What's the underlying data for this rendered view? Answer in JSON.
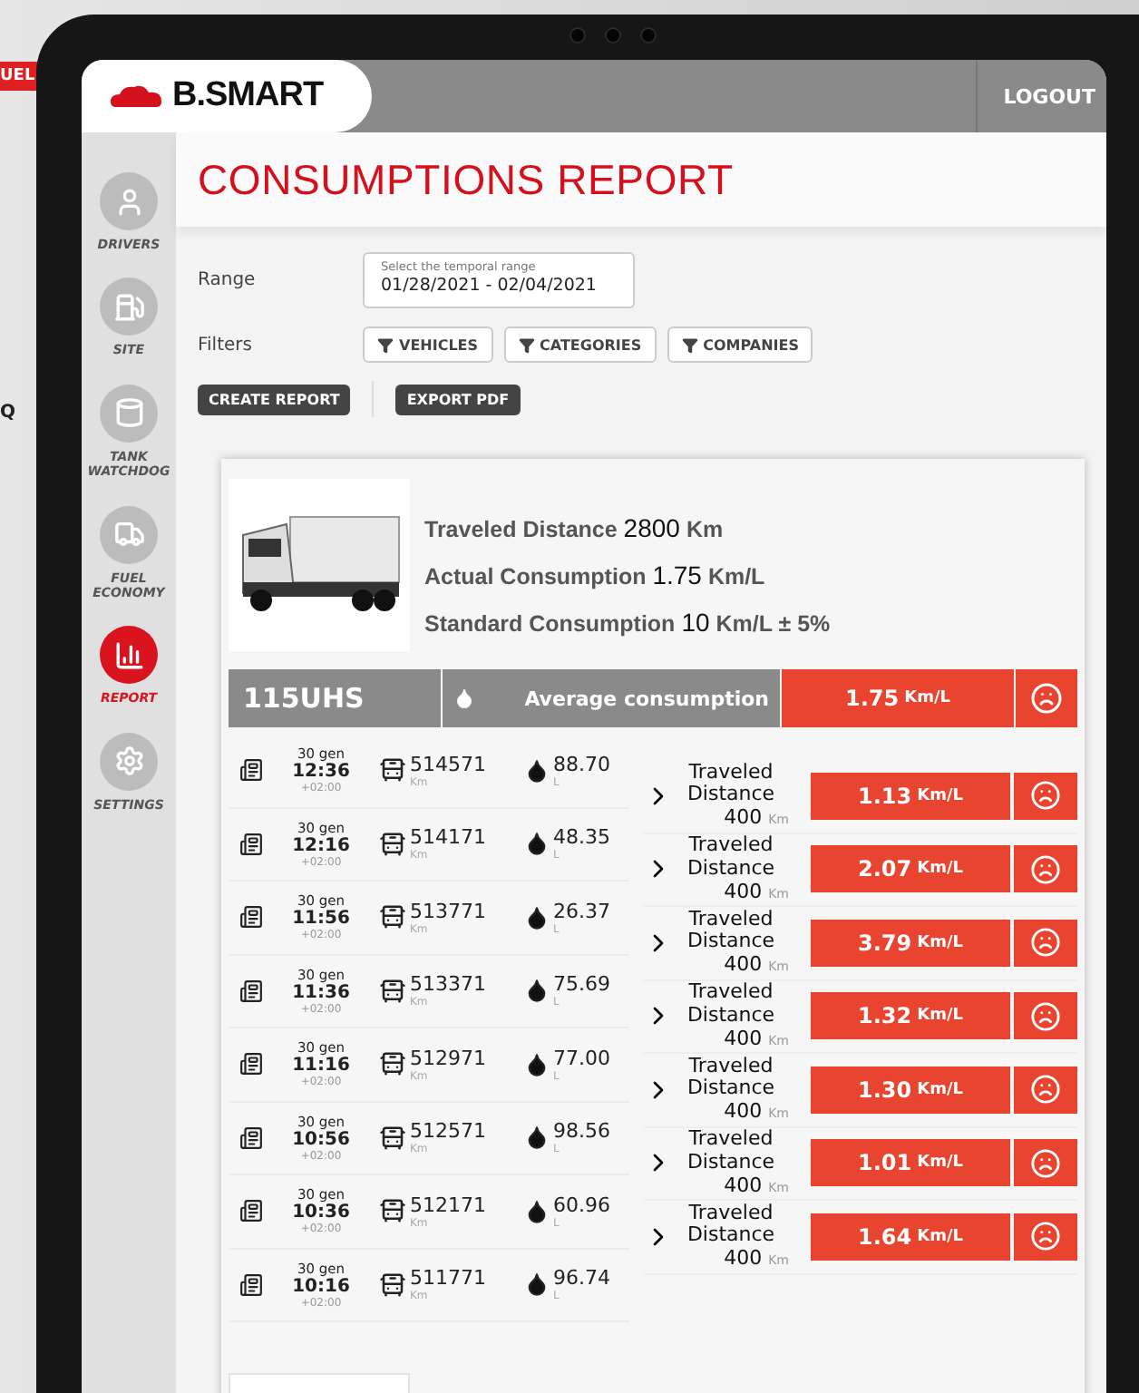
{
  "background": {
    "badge": "UEL",
    "letter": "Q"
  },
  "header": {
    "logo": "B.SMART",
    "logout": "LOGOUT"
  },
  "sidebar": {
    "items": [
      {
        "label": "DRIVERS",
        "selected": false
      },
      {
        "label": "SITE",
        "selected": false
      },
      {
        "label": "TANK WATCHDOG",
        "selected": false
      },
      {
        "label": "FUEL ECONOMY",
        "selected": false
      },
      {
        "label": "REPORT",
        "selected": true
      },
      {
        "label": "SETTINGS",
        "selected": false
      }
    ]
  },
  "title": "CONSUMPTIONS REPORT",
  "range": {
    "label": "Range",
    "field_label": "Select the temporal range",
    "value": "01/28/2021 - 02/04/2021"
  },
  "filters": {
    "label": "Filters",
    "buttons": [
      "VEHICLES",
      "CATEGORIES",
      "COMPANIES"
    ]
  },
  "actions": [
    "CREATE REPORT",
    "EXPORT PDF"
  ],
  "vehicle": {
    "stats": [
      {
        "label": "Traveled Distance",
        "value": "2800",
        "unit": "Km"
      },
      {
        "label": "Actual Consumption",
        "value": "1.75",
        "unit": "Km/L"
      },
      {
        "label": "Standard Consumption",
        "value": "10",
        "unit": "Km/L",
        "extra": "± 5%"
      }
    ],
    "plate": "115UHS",
    "average_label": "Average consumption",
    "average_value": "1.75",
    "average_unit": "Km/L",
    "readings": [
      {
        "date": "30 gen",
        "time": "12:36",
        "tz": "+02:00",
        "odometer": "514571",
        "odometer_unit": "Km",
        "liters": "88.70",
        "liters_unit": "L"
      },
      {
        "date": "30 gen",
        "time": "12:16",
        "tz": "+02:00",
        "odometer": "514171",
        "odometer_unit": "Km",
        "liters": "48.35",
        "liters_unit": "L"
      },
      {
        "date": "30 gen",
        "time": "11:56",
        "tz": "+02:00",
        "odometer": "513771",
        "odometer_unit": "Km",
        "liters": "26.37",
        "liters_unit": "L"
      },
      {
        "date": "30 gen",
        "time": "11:36",
        "tz": "+02:00",
        "odometer": "513371",
        "odometer_unit": "Km",
        "liters": "75.69",
        "liters_unit": "L"
      },
      {
        "date": "30 gen",
        "time": "11:16",
        "tz": "+02:00",
        "odometer": "512971",
        "odometer_unit": "Km",
        "liters": "77.00",
        "liters_unit": "L"
      },
      {
        "date": "30 gen",
        "time": "10:56",
        "tz": "+02:00",
        "odometer": "512571",
        "odometer_unit": "Km",
        "liters": "98.56",
        "liters_unit": "L"
      },
      {
        "date": "30 gen",
        "time": "10:36",
        "tz": "+02:00",
        "odometer": "512171",
        "odometer_unit": "Km",
        "liters": "60.96",
        "liters_unit": "L"
      },
      {
        "date": "30 gen",
        "time": "10:16",
        "tz": "+02:00",
        "odometer": "511771",
        "odometer_unit": "Km",
        "liters": "96.74",
        "liters_unit": "L"
      }
    ],
    "segments": [
      {
        "label": "Traveled Distance",
        "distance": "400",
        "distance_unit": "Km",
        "consumption": "1.13",
        "consumption_unit": "Km/L"
      },
      {
        "label": "Traveled Distance",
        "distance": "400",
        "distance_unit": "Km",
        "consumption": "2.07",
        "consumption_unit": "Km/L"
      },
      {
        "label": "Traveled Distance",
        "distance": "400",
        "distance_unit": "Km",
        "consumption": "3.79",
        "consumption_unit": "Km/L"
      },
      {
        "label": "Traveled Distance",
        "distance": "400",
        "distance_unit": "Km",
        "consumption": "1.32",
        "consumption_unit": "Km/L"
      },
      {
        "label": "Traveled Distance",
        "distance": "400",
        "distance_unit": "Km",
        "consumption": "1.30",
        "consumption_unit": "Km/L"
      },
      {
        "label": "Traveled Distance",
        "distance": "400",
        "distance_unit": "Km",
        "consumption": "1.01",
        "consumption_unit": "Km/L"
      },
      {
        "label": "Traveled Distance",
        "distance": "400",
        "distance_unit": "Km",
        "consumption": "1.64",
        "consumption_unit": "Km/L"
      }
    ]
  }
}
